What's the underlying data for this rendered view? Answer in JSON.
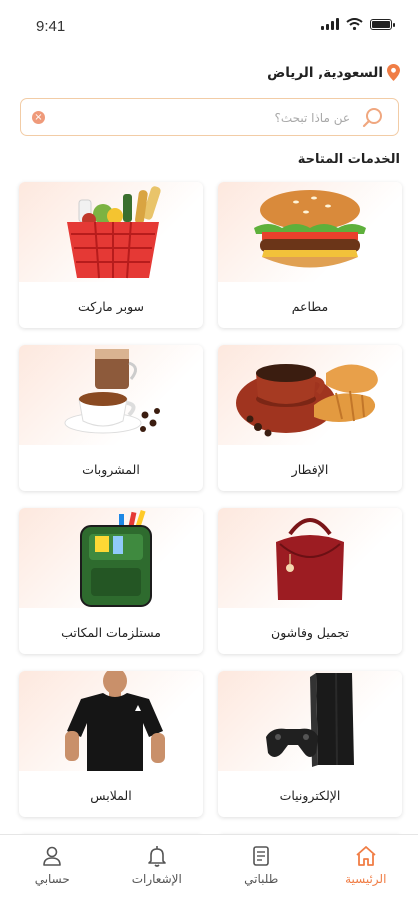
{
  "status_bar": {
    "time": "9:41"
  },
  "location": {
    "text": "السعودية, الرياض"
  },
  "search": {
    "placeholder": "عن ماذا تبحث؟"
  },
  "section_title": "الخدمات المتاحة",
  "services": [
    {
      "label": "مطاعم",
      "icon": "burger-icon"
    },
    {
      "label": "سوبر ماركت",
      "icon": "grocery-basket-icon"
    },
    {
      "label": "الإفطار",
      "icon": "coffee-croissant-icon"
    },
    {
      "label": "المشروبات",
      "icon": "coffee-drinks-icon"
    },
    {
      "label": "تجميل وفاشون",
      "icon": "handbag-icon"
    },
    {
      "label": "مستلزمات المكاتب",
      "icon": "school-bag-icon"
    },
    {
      "label": "الإلكترونيات",
      "icon": "game-console-icon"
    },
    {
      "label": "الملابس",
      "icon": "tshirt-icon"
    }
  ],
  "bottom_nav": [
    {
      "label": "الرئيسية",
      "icon": "home-icon",
      "active": true
    },
    {
      "label": "طلباتي",
      "icon": "orders-icon",
      "active": false
    },
    {
      "label": "الإشعارات",
      "icon": "bell-icon",
      "active": false
    },
    {
      "label": "حسابي",
      "icon": "user-icon",
      "active": false
    }
  ],
  "colors": {
    "accent": "#f07d45",
    "border": "#f2cca6",
    "card_tint": "#fde8de"
  }
}
